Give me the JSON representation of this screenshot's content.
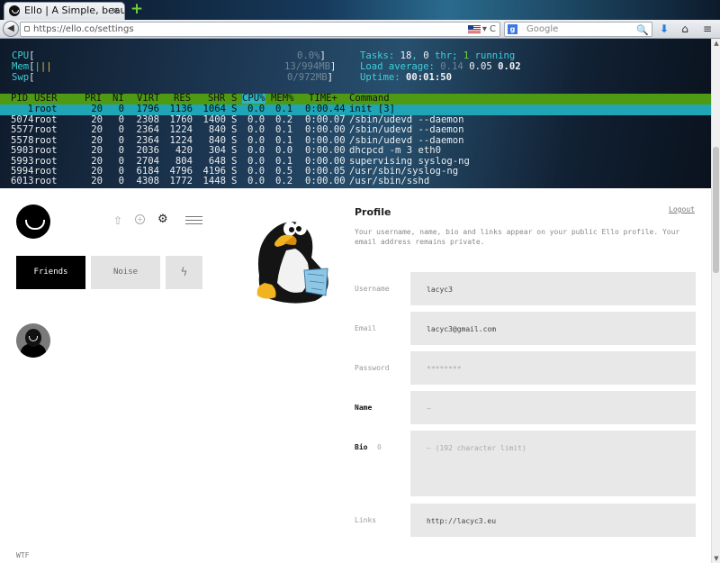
{
  "browser": {
    "tab_title": "Ello | A Simple, beau...",
    "tab_close": "×",
    "new_tab": "+",
    "url": "https://ello.co/settings",
    "url_buttons": "▾ C",
    "search_engine_badge": "g",
    "search_placeholder": "Google",
    "back_icon": "◀",
    "search_icon": "🔍",
    "download_icon": "⬇",
    "home_icon": "⌂",
    "menu_icon": "≡"
  },
  "terminal": {
    "meters": {
      "cpu_label": "CPU",
      "cpu_value": "0.0%",
      "mem_label": "Mem",
      "mem_value": "13/994MB",
      "swp_label": "Swp",
      "swp_value": "0/972MB"
    },
    "summary": {
      "tasks_label": "Tasks: ",
      "tasks": "18",
      "thr": "0",
      "thr_label": " thr; ",
      "running": "1",
      "running_label": " running",
      "load_label": "Load average: ",
      "load1": "0.14",
      "load5": "0.05",
      "load15": "0.02",
      "uptime_label": "Uptime: ",
      "uptime": "00:01:50"
    },
    "columns": [
      "PID",
      "USER",
      "PRI",
      "NI",
      "VIRT",
      "RES",
      "SHR",
      "S",
      "CPU%",
      "MEM%",
      "TIME+",
      "Command"
    ],
    "rows": [
      {
        "pid": "1",
        "user": "root",
        "pri": "20",
        "ni": "0",
        "virt": "1796",
        "res": "1136",
        "shr": "1064",
        "s": "S",
        "cpu": "0.0",
        "mem": "0.1",
        "time": "0:00.44",
        "cmd": "init [3]"
      },
      {
        "pid": "5074",
        "user": "root",
        "pri": "20",
        "ni": "0",
        "virt": "2308",
        "res": "1760",
        "shr": "1400",
        "s": "S",
        "cpu": "0.0",
        "mem": "0.2",
        "time": "0:00.07",
        "cmd": "/sbin/udevd --daemon"
      },
      {
        "pid": "5577",
        "user": "root",
        "pri": "20",
        "ni": "0",
        "virt": "2364",
        "res": "1224",
        "shr": "840",
        "s": "S",
        "cpu": "0.0",
        "mem": "0.1",
        "time": "0:00.00",
        "cmd": "/sbin/udevd --daemon"
      },
      {
        "pid": "5578",
        "user": "root",
        "pri": "20",
        "ni": "0",
        "virt": "2364",
        "res": "1224",
        "shr": "840",
        "s": "S",
        "cpu": "0.0",
        "mem": "0.1",
        "time": "0:00.00",
        "cmd": "/sbin/udevd --daemon"
      },
      {
        "pid": "5903",
        "user": "root",
        "pri": "20",
        "ni": "0",
        "virt": "2036",
        "res": "420",
        "shr": "304",
        "s": "S",
        "cpu": "0.0",
        "mem": "0.0",
        "time": "0:00.00",
        "cmd": "dhcpcd -m 3 eth0"
      },
      {
        "pid": "5993",
        "user": "root",
        "pri": "20",
        "ni": "0",
        "virt": "2704",
        "res": "804",
        "shr": "648",
        "s": "S",
        "cpu": "0.0",
        "mem": "0.1",
        "time": "0:00.00",
        "cmd": "supervising syslog-ng"
      },
      {
        "pid": "5994",
        "user": "root",
        "pri": "20",
        "ni": "0",
        "virt": "6184",
        "res": "4796",
        "shr": "4196",
        "s": "S",
        "cpu": "0.0",
        "mem": "0.5",
        "time": "0:00.05",
        "cmd": "/usr/sbin/syslog-ng"
      },
      {
        "pid": "6013",
        "user": "root",
        "pri": "20",
        "ni": "0",
        "virt": "4308",
        "res": "1772",
        "shr": "1448",
        "s": "S",
        "cpu": "0.0",
        "mem": "0.2",
        "time": "0:00.00",
        "cmd": "/usr/sbin/sshd"
      }
    ]
  },
  "sidebar": {
    "share_icon": "⇧",
    "circle_plus_icon": "+",
    "gear_icon": "⚙",
    "bolt_icon": "ϟ",
    "friends_label": "Friends",
    "noise_label": "Noise",
    "wtf_label": "WTF"
  },
  "profile": {
    "title": "Profile",
    "logout_label": "Logout",
    "description": "Your username, name, bio and links appear on your public Ello profile. Your email address remains private.",
    "fields": {
      "username_label": "Username",
      "username_value": "lacyc3",
      "email_label": "Email",
      "email_value": "lacyc3@gmail.com",
      "password_label": "Password",
      "password_value": "********",
      "name_label": "Name",
      "name_placeholder": "—",
      "bio_label": "Bio",
      "bio_count": "0",
      "bio_placeholder": "— (192 character limit)",
      "links_label": "Links",
      "links_value": "http://lacyc3.eu"
    }
  }
}
